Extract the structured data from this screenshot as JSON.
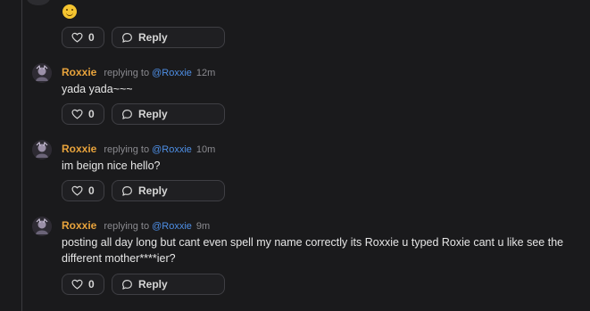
{
  "top": {
    "emoji": "smiling-face",
    "like_count": "0",
    "reply_label": "Reply"
  },
  "comments": [
    {
      "author": "Roxxie",
      "replying_text": "replying to",
      "mention": "@Roxxie",
      "time": "12m",
      "body": "yada yada~~~",
      "like_count": "0",
      "reply_label": "Reply"
    },
    {
      "author": "Roxxie",
      "replying_text": "replying to",
      "mention": "@Roxxie",
      "time": "10m",
      "body": "im beign nice hello?",
      "like_count": "0",
      "reply_label": "Reply"
    },
    {
      "author": "Roxxie",
      "replying_text": "replying to",
      "mention": "@Roxxie",
      "time": "9m",
      "body": "posting all day long but cant even spell my name correctly its Roxxie u typed Roxie cant u like see the different mother****ier?",
      "like_count": "0",
      "reply_label": "Reply"
    }
  ],
  "colors": {
    "background": "#1a1a1c",
    "author": "#e8a33c",
    "mention": "#4e8fe6",
    "muted": "#8a8a8f",
    "button_border": "#3f3f44"
  },
  "icons": {
    "like": "heart-icon",
    "reply": "speech-bubble-icon"
  }
}
